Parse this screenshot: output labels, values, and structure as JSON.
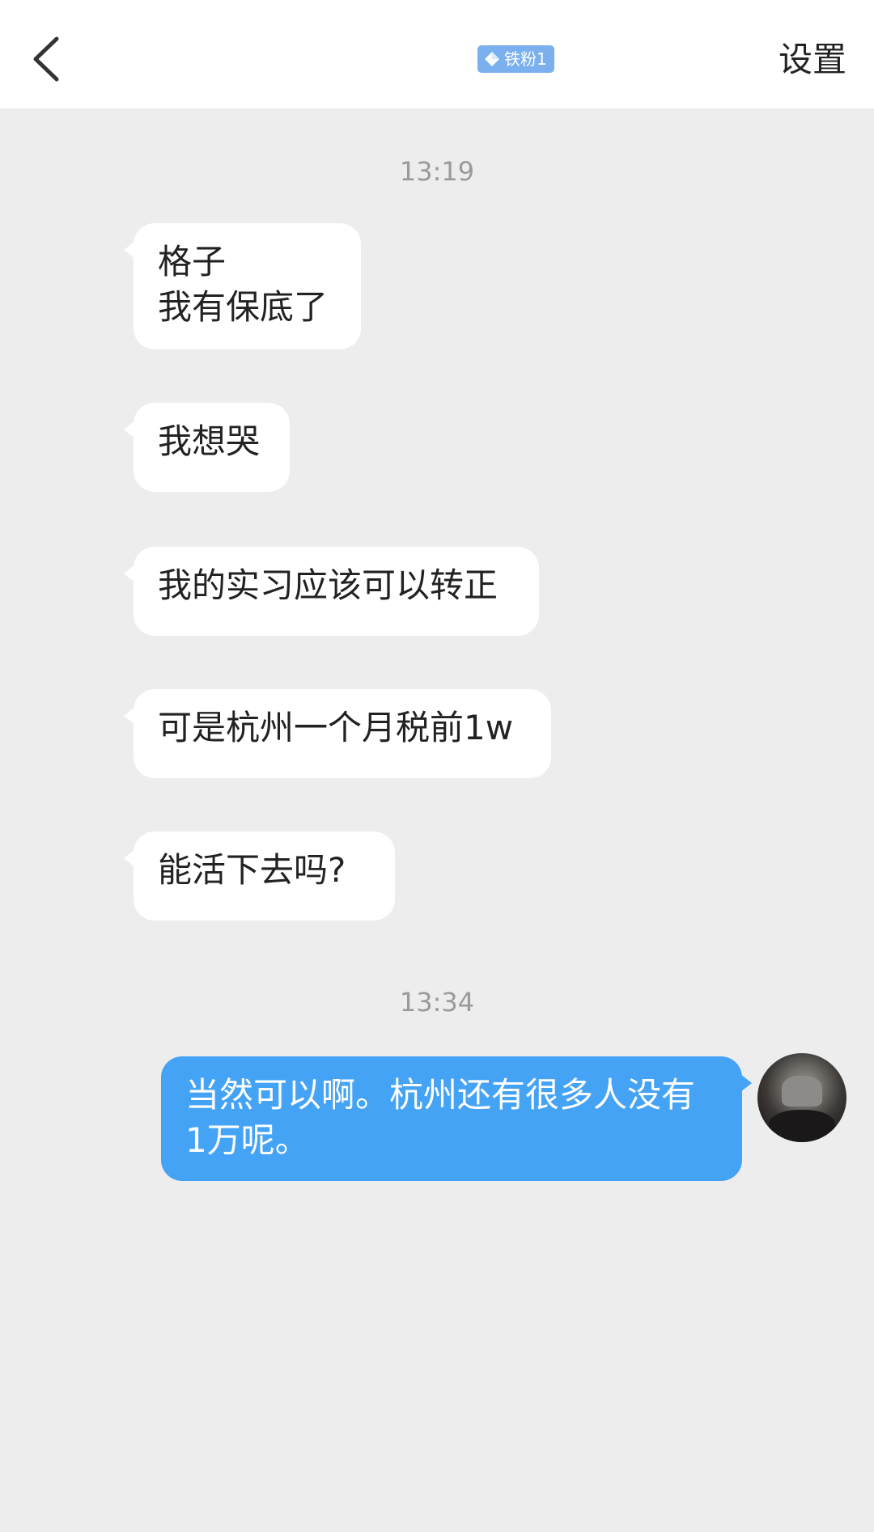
{
  "header": {
    "back_icon": "chevron-left-icon",
    "badge": {
      "icon": "diamond-icon",
      "label": "铁粉1",
      "color": "#7ab0ee"
    },
    "settings_label": "设置"
  },
  "messages": {
    "time_1": "13:19",
    "in_1": "格子\n我有保底了",
    "in_2": "我想哭",
    "in_3": "我的实习应该可以转正",
    "in_4": "可是杭州一个月税前1w",
    "in_5": "能活下去吗?",
    "time_2": "13:34",
    "out_1": "当然可以啊。杭州还有很多人没有\n1万呢。"
  },
  "colors": {
    "background": "#ededed",
    "incoming_bubble": "#ffffff",
    "outgoing_bubble": "#45a3f6",
    "timestamp": "#9a9a9a"
  }
}
